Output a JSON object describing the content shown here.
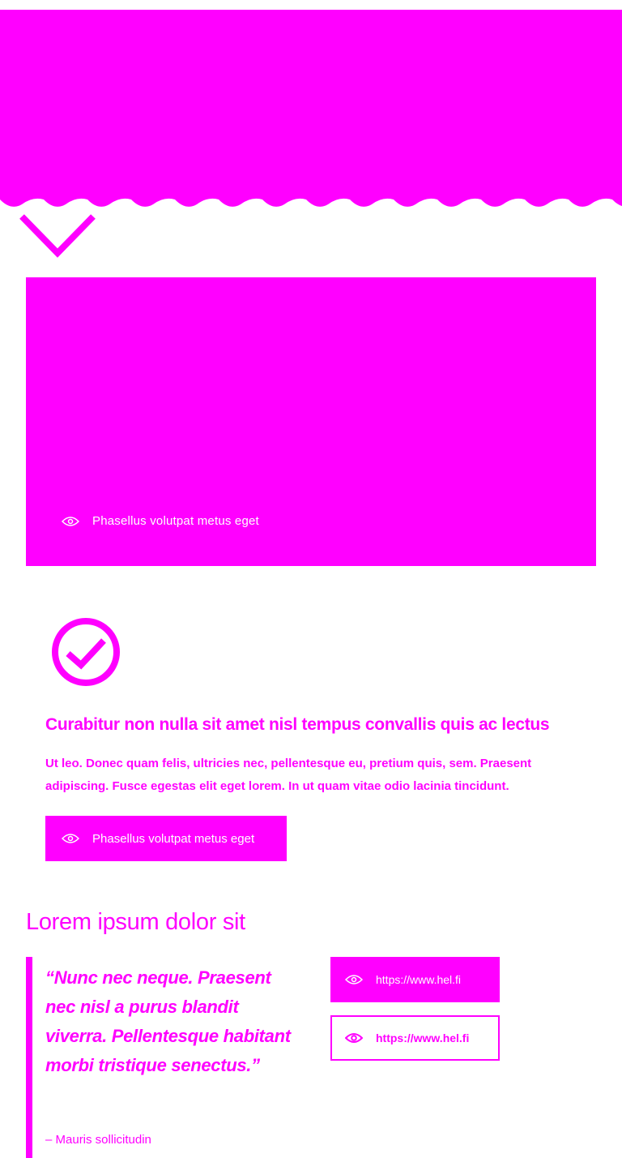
{
  "colors": {
    "brand": "#ff00ff",
    "background": "#ffffff",
    "on_brand": "#ffffff"
  },
  "media": {
    "caption": "Phasellus volutpat metus eget",
    "caption_icon": "eye-icon"
  },
  "card": {
    "icon": "check-circle-icon",
    "title": "Curabitur non nulla sit amet nisl tempus convallis quis ac lectus",
    "text": "Ut leo. Donec quam felis, ultricies nec, pellentesque eu, pretium quis, sem. Praesent adipiscing. Fusce egestas elit eget lorem. In ut quam vitae odio lacinia tincidunt.",
    "button_label": "Phasellus volutpat metus eget",
    "button_icon": "eye-icon"
  },
  "section": {
    "heading": "Lorem ipsum dolor sit",
    "quote": "“Nunc nec neque. Praesent nec nisl a purus blandit viverra. Pellentesque habitant morbi tristique senectus.”",
    "author": "– Mauris sollicitudin",
    "links": [
      {
        "label": "https://www.hel.fi",
        "style": "filled",
        "icon": "eye-icon"
      },
      {
        "label": "https://www.hel.fi",
        "style": "outline",
        "icon": "eye-icon"
      }
    ]
  },
  "decorations": {
    "hero_wave": "wave-edge",
    "scroll_indicator": "chevron-down-icon"
  }
}
